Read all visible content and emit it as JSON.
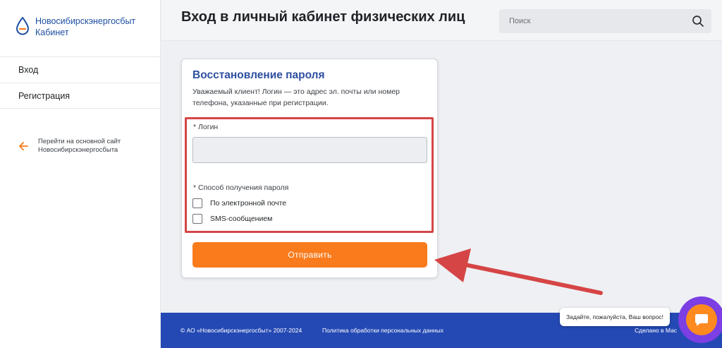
{
  "brand": {
    "name": "Новосибирскэнергосбыт",
    "subtitle": "Кабинет",
    "logo_icon": "drop-logo-icon",
    "color": "#1e4fa3"
  },
  "sidebar": {
    "items": [
      {
        "label": "Вход"
      },
      {
        "label": "Регистрация"
      }
    ],
    "back_link": "Перейти на основной сайт Новосибирскэнергосбыта",
    "back_icon": "arrow-left-icon",
    "accent": "#f97b1c"
  },
  "header": {
    "title": "Вход в личный кабинет физических лиц",
    "search_placeholder": "Поиск",
    "search_icon": "search-icon"
  },
  "form": {
    "title": "Восстановление пароля",
    "description": "Уважаемый клиент! Логин — это адрес эл. почты или номер телефона, указанные при регистрации.",
    "login_label": "* Логин",
    "login_value": "",
    "method_label": "* Способ получения пароля",
    "options": [
      {
        "label": "По электронной почте",
        "checked": false
      },
      {
        "label": "SMS-сообщением",
        "checked": false
      }
    ],
    "submit_label": "Отправить",
    "submit_color": "#f97b1c"
  },
  "footer": {
    "copyright": "© АО «Новосибирскэнергосбыт» 2007-2024",
    "policy": "Политика обработки персональных данных",
    "made_by": "Сделано в Мас",
    "background": "#2449b4"
  },
  "chat": {
    "prompt": "Задайте, пожалуйста, Ваш вопрос!",
    "icon": "chat-icon"
  },
  "annotation": {
    "color": "#d64545"
  }
}
